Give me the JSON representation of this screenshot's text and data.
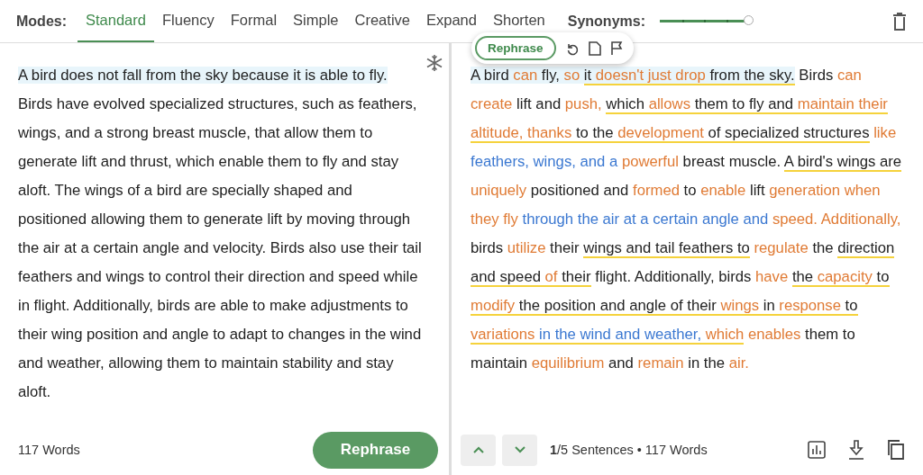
{
  "modes": {
    "label": "Modes:",
    "tabs": [
      {
        "label": "Standard",
        "selected": true
      },
      {
        "label": "Fluency",
        "selected": false
      },
      {
        "label": "Formal",
        "selected": false
      },
      {
        "label": "Simple",
        "selected": false
      },
      {
        "label": "Creative",
        "selected": false
      },
      {
        "label": "Expand",
        "selected": false
      },
      {
        "label": "Shorten",
        "selected": false
      }
    ]
  },
  "synonyms": {
    "label": "Synonyms:",
    "level": 1.0
  },
  "input": {
    "segments": [
      {
        "text": "A bird does not fall from the sky because it is able to fly.",
        "highlight": true
      },
      {
        "text": " Birds have evolved specialized structures, such as feathers, wings, and a strong breast muscle, that allow them to generate lift and thrust, which enable them to fly and stay aloft. The wings of a bird are specially shaped and positioned allowing them to generate lift by moving through the air at a certain angle and velocity. Birds also use their tail feathers and wings to control their direction and speed while in flight. Additionally, birds are able to make adjustments to their wing position and angle to adapt to changes in the wind and weather, allowing them to maintain stability and stay aloft.",
        "highlight": false
      }
    ],
    "word_count": "117 Words",
    "button": "Rephrase"
  },
  "sentence_toolbar": {
    "button": "Rephrase"
  },
  "output": {
    "segments": [
      {
        "text": "A bird ",
        "kind": "plain",
        "underline": false,
        "highlight": true
      },
      {
        "text": "can",
        "kind": "changed",
        "underline": false,
        "highlight": true
      },
      {
        "text": " fly, ",
        "kind": "plain",
        "underline": false,
        "highlight": true
      },
      {
        "text": "so ",
        "kind": "changed",
        "underline": false,
        "highlight": true
      },
      {
        "text": "it ",
        "kind": "plain",
        "underline": true,
        "highlight": true
      },
      {
        "text": "doesn't just drop",
        "kind": "changed",
        "underline": true,
        "highlight": true
      },
      {
        "text": " from the sky.",
        "kind": "plain",
        "underline": true,
        "highlight": true
      },
      {
        "text": " Birds ",
        "kind": "plain",
        "underline": false,
        "highlight": false
      },
      {
        "text": "can create",
        "kind": "changed",
        "underline": false,
        "highlight": false
      },
      {
        "text": " lift and ",
        "kind": "plain",
        "underline": false,
        "highlight": false
      },
      {
        "text": "push, ",
        "kind": "changed",
        "underline": false,
        "highlight": false
      },
      {
        "text": "which ",
        "kind": "plain",
        "underline": true,
        "highlight": false
      },
      {
        "text": "allows",
        "kind": "changed",
        "underline": true,
        "highlight": false
      },
      {
        "text": " them to fly and ",
        "kind": "plain",
        "underline": true,
        "highlight": false
      },
      {
        "text": "maintain their altitude, thanks",
        "kind": "changed",
        "underline": true,
        "highlight": false
      },
      {
        "text": " to the ",
        "kind": "plain",
        "underline": true,
        "highlight": false
      },
      {
        "text": "development",
        "kind": "changed",
        "underline": true,
        "highlight": false
      },
      {
        "text": " of specialized structures",
        "kind": "plain",
        "underline": true,
        "highlight": false
      },
      {
        "text": " like ",
        "kind": "changed",
        "underline": false,
        "highlight": false
      },
      {
        "text": "feathers, wings, and a ",
        "kind": "structure",
        "underline": false,
        "highlight": false
      },
      {
        "text": "powerful",
        "kind": "changed",
        "underline": false,
        "highlight": false
      },
      {
        "text": " breast muscle. ",
        "kind": "plain",
        "underline": false,
        "highlight": false
      },
      {
        "text": "A bird's wings are",
        "kind": "plain",
        "underline": true,
        "highlight": false
      },
      {
        "text": " uniquely",
        "kind": "changed",
        "underline": false,
        "highlight": false
      },
      {
        "text": " positioned and ",
        "kind": "plain",
        "underline": false,
        "highlight": false
      },
      {
        "text": "formed",
        "kind": "changed",
        "underline": false,
        "highlight": false
      },
      {
        "text": " to ",
        "kind": "plain",
        "underline": false,
        "highlight": false
      },
      {
        "text": "enable",
        "kind": "changed",
        "underline": false,
        "highlight": false
      },
      {
        "text": " lift ",
        "kind": "plain",
        "underline": false,
        "highlight": false
      },
      {
        "text": "generation when they fly ",
        "kind": "changed",
        "underline": false,
        "highlight": false
      },
      {
        "text": "through the air at a certain angle and ",
        "kind": "structure",
        "underline": false,
        "highlight": false
      },
      {
        "text": "speed. Additionally,",
        "kind": "changed",
        "underline": false,
        "highlight": false
      },
      {
        "text": " birds ",
        "kind": "plain",
        "underline": false,
        "highlight": false
      },
      {
        "text": "utilize",
        "kind": "changed",
        "underline": false,
        "highlight": false
      },
      {
        "text": " their ",
        "kind": "plain",
        "underline": false,
        "highlight": false
      },
      {
        "text": "wings and tail feathers to",
        "kind": "plain",
        "underline": true,
        "highlight": false
      },
      {
        "text": " regulate",
        "kind": "changed",
        "underline": false,
        "highlight": false
      },
      {
        "text": " the ",
        "kind": "plain",
        "underline": false,
        "highlight": false
      },
      {
        "text": "direction and speed ",
        "kind": "plain",
        "underline": true,
        "highlight": false
      },
      {
        "text": "of",
        "kind": "changed",
        "underline": true,
        "highlight": false
      },
      {
        "text": " their",
        "kind": "plain",
        "underline": true,
        "highlight": false
      },
      {
        "text": " flight. Additionally, birds ",
        "kind": "plain",
        "underline": false,
        "highlight": false
      },
      {
        "text": "have ",
        "kind": "changed",
        "underline": false,
        "highlight": false
      },
      {
        "text": "the ",
        "kind": "plain",
        "underline": true,
        "highlight": false
      },
      {
        "text": "capacity",
        "kind": "changed",
        "underline": true,
        "highlight": false
      },
      {
        "text": " to ",
        "kind": "plain",
        "underline": true,
        "highlight": false
      },
      {
        "text": "modify",
        "kind": "changed",
        "underline": true,
        "highlight": false
      },
      {
        "text": " the position and angle of their ",
        "kind": "plain",
        "underline": true,
        "highlight": false
      },
      {
        "text": "wings",
        "kind": "changed",
        "underline": true,
        "highlight": false
      },
      {
        "text": " in ",
        "kind": "plain",
        "underline": true,
        "highlight": false
      },
      {
        "text": "response",
        "kind": "changed",
        "underline": true,
        "highlight": false
      },
      {
        "text": " to ",
        "kind": "plain",
        "underline": true,
        "highlight": false
      },
      {
        "text": "variations ",
        "kind": "changed",
        "underline": true,
        "highlight": false
      },
      {
        "text": "in the wind and weather, ",
        "kind": "structure",
        "underline": true,
        "highlight": false
      },
      {
        "text": "which",
        "kind": "changed",
        "underline": true,
        "highlight": false
      },
      {
        "text": " enables",
        "kind": "changed",
        "underline": false,
        "highlight": false
      },
      {
        "text": " them to maintain ",
        "kind": "plain",
        "underline": false,
        "highlight": false
      },
      {
        "text": "equilibrium",
        "kind": "changed",
        "underline": false,
        "highlight": false
      },
      {
        "text": " and ",
        "kind": "plain",
        "underline": false,
        "highlight": false
      },
      {
        "text": "remain",
        "kind": "changed",
        "underline": false,
        "highlight": false
      },
      {
        "text": " in the ",
        "kind": "plain",
        "underline": false,
        "highlight": false
      },
      {
        "text": "air.",
        "kind": "changed",
        "underline": false,
        "highlight": false
      }
    ],
    "stats": "**1**/5 Sentences • 117 Words"
  }
}
